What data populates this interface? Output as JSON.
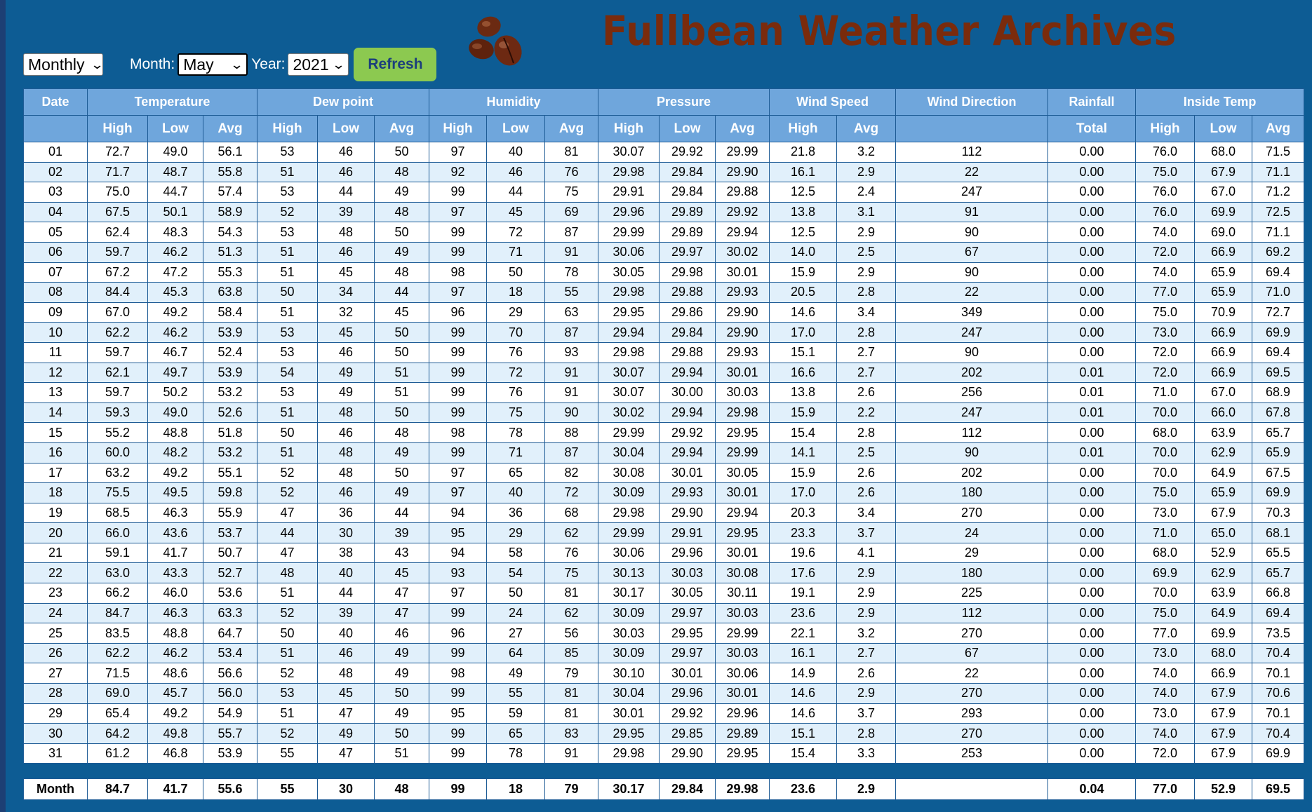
{
  "controls": {
    "period": "Monthly",
    "month_label": "Month:",
    "month": "May",
    "year_label": "Year:",
    "year": "2021",
    "refresh_label": "Refresh"
  },
  "title": "Fullbean Weather Archives",
  "headers": {
    "groups": [
      "Date",
      "Temperature",
      "Dew point",
      "Humidity",
      "Pressure",
      "Wind Speed",
      "Wind Direction",
      "Rainfall",
      "Inside Temp"
    ],
    "sub": [
      "",
      "High",
      "Low",
      "Avg",
      "High",
      "Low",
      "Avg",
      "High",
      "Low",
      "Avg",
      "High",
      "Low",
      "Avg",
      "High",
      "Avg",
      "",
      "Total",
      "High",
      "Low",
      "Avg"
    ]
  },
  "rows": [
    [
      "01",
      "72.7",
      "49.0",
      "56.1",
      "53",
      "46",
      "50",
      "97",
      "40",
      "81",
      "30.07",
      "29.92",
      "29.99",
      "21.8",
      "3.2",
      "112",
      "0.00",
      "76.0",
      "68.0",
      "71.5"
    ],
    [
      "02",
      "71.7",
      "48.7",
      "55.8",
      "51",
      "46",
      "48",
      "92",
      "46",
      "76",
      "29.98",
      "29.84",
      "29.90",
      "16.1",
      "2.9",
      "22",
      "0.00",
      "75.0",
      "67.9",
      "71.1"
    ],
    [
      "03",
      "75.0",
      "44.7",
      "57.4",
      "53",
      "44",
      "49",
      "99",
      "44",
      "75",
      "29.91",
      "29.84",
      "29.88",
      "12.5",
      "2.4",
      "247",
      "0.00",
      "76.0",
      "67.0",
      "71.2"
    ],
    [
      "04",
      "67.5",
      "50.1",
      "58.9",
      "52",
      "39",
      "48",
      "97",
      "45",
      "69",
      "29.96",
      "29.89",
      "29.92",
      "13.8",
      "3.1",
      "91",
      "0.00",
      "76.0",
      "69.9",
      "72.5"
    ],
    [
      "05",
      "62.4",
      "48.3",
      "54.3",
      "53",
      "48",
      "50",
      "99",
      "72",
      "87",
      "29.99",
      "29.89",
      "29.94",
      "12.5",
      "2.9",
      "90",
      "0.00",
      "74.0",
      "69.0",
      "71.1"
    ],
    [
      "06",
      "59.7",
      "46.2",
      "51.3",
      "51",
      "46",
      "49",
      "99",
      "71",
      "91",
      "30.06",
      "29.97",
      "30.02",
      "14.0",
      "2.5",
      "67",
      "0.00",
      "72.0",
      "66.9",
      "69.2"
    ],
    [
      "07",
      "67.2",
      "47.2",
      "55.3",
      "51",
      "45",
      "48",
      "98",
      "50",
      "78",
      "30.05",
      "29.98",
      "30.01",
      "15.9",
      "2.9",
      "90",
      "0.00",
      "74.0",
      "65.9",
      "69.4"
    ],
    [
      "08",
      "84.4",
      "45.3",
      "63.8",
      "50",
      "34",
      "44",
      "97",
      "18",
      "55",
      "29.98",
      "29.88",
      "29.93",
      "20.5",
      "2.8",
      "22",
      "0.00",
      "77.0",
      "65.9",
      "71.0"
    ],
    [
      "09",
      "67.0",
      "49.2",
      "58.4",
      "51",
      "32",
      "45",
      "96",
      "29",
      "63",
      "29.95",
      "29.86",
      "29.90",
      "14.6",
      "3.4",
      "349",
      "0.00",
      "75.0",
      "70.9",
      "72.7"
    ],
    [
      "10",
      "62.2",
      "46.2",
      "53.9",
      "53",
      "45",
      "50",
      "99",
      "70",
      "87",
      "29.94",
      "29.84",
      "29.90",
      "17.0",
      "2.8",
      "247",
      "0.00",
      "73.0",
      "66.9",
      "69.9"
    ],
    [
      "11",
      "59.7",
      "46.7",
      "52.4",
      "53",
      "46",
      "50",
      "99",
      "76",
      "93",
      "29.98",
      "29.88",
      "29.93",
      "15.1",
      "2.7",
      "90",
      "0.00",
      "72.0",
      "66.9",
      "69.4"
    ],
    [
      "12",
      "62.1",
      "49.7",
      "53.9",
      "54",
      "49",
      "51",
      "99",
      "72",
      "91",
      "30.07",
      "29.94",
      "30.01",
      "16.6",
      "2.7",
      "202",
      "0.01",
      "72.0",
      "66.9",
      "69.5"
    ],
    [
      "13",
      "59.7",
      "50.2",
      "53.2",
      "53",
      "49",
      "51",
      "99",
      "76",
      "91",
      "30.07",
      "30.00",
      "30.03",
      "13.8",
      "2.6",
      "256",
      "0.01",
      "71.0",
      "67.0",
      "68.9"
    ],
    [
      "14",
      "59.3",
      "49.0",
      "52.6",
      "51",
      "48",
      "50",
      "99",
      "75",
      "90",
      "30.02",
      "29.94",
      "29.98",
      "15.9",
      "2.2",
      "247",
      "0.01",
      "70.0",
      "66.0",
      "67.8"
    ],
    [
      "15",
      "55.2",
      "48.8",
      "51.8",
      "50",
      "46",
      "48",
      "98",
      "78",
      "88",
      "29.99",
      "29.92",
      "29.95",
      "15.4",
      "2.8",
      "112",
      "0.00",
      "68.0",
      "63.9",
      "65.7"
    ],
    [
      "16",
      "60.0",
      "48.2",
      "53.2",
      "51",
      "48",
      "49",
      "99",
      "71",
      "87",
      "30.04",
      "29.94",
      "29.99",
      "14.1",
      "2.5",
      "90",
      "0.01",
      "70.0",
      "62.9",
      "65.9"
    ],
    [
      "17",
      "63.2",
      "49.2",
      "55.1",
      "52",
      "48",
      "50",
      "97",
      "65",
      "82",
      "30.08",
      "30.01",
      "30.05",
      "15.9",
      "2.6",
      "202",
      "0.00",
      "70.0",
      "64.9",
      "67.5"
    ],
    [
      "18",
      "75.5",
      "49.5",
      "59.8",
      "52",
      "46",
      "49",
      "97",
      "40",
      "72",
      "30.09",
      "29.93",
      "30.01",
      "17.0",
      "2.6",
      "180",
      "0.00",
      "75.0",
      "65.9",
      "69.9"
    ],
    [
      "19",
      "68.5",
      "46.3",
      "55.9",
      "47",
      "36",
      "44",
      "94",
      "36",
      "68",
      "29.98",
      "29.90",
      "29.94",
      "20.3",
      "3.4",
      "270",
      "0.00",
      "73.0",
      "67.9",
      "70.3"
    ],
    [
      "20",
      "66.0",
      "43.6",
      "53.7",
      "44",
      "30",
      "39",
      "95",
      "29",
      "62",
      "29.99",
      "29.91",
      "29.95",
      "23.3",
      "3.7",
      "24",
      "0.00",
      "71.0",
      "65.0",
      "68.1"
    ],
    [
      "21",
      "59.1",
      "41.7",
      "50.7",
      "47",
      "38",
      "43",
      "94",
      "58",
      "76",
      "30.06",
      "29.96",
      "30.01",
      "19.6",
      "4.1",
      "29",
      "0.00",
      "68.0",
      "52.9",
      "65.5"
    ],
    [
      "22",
      "63.0",
      "43.3",
      "52.7",
      "48",
      "40",
      "45",
      "93",
      "54",
      "75",
      "30.13",
      "30.03",
      "30.08",
      "17.6",
      "2.9",
      "180",
      "0.00",
      "69.9",
      "62.9",
      "65.7"
    ],
    [
      "23",
      "66.2",
      "46.0",
      "53.6",
      "51",
      "44",
      "47",
      "97",
      "50",
      "81",
      "30.17",
      "30.05",
      "30.11",
      "19.1",
      "2.9",
      "225",
      "0.00",
      "70.0",
      "63.9",
      "66.8"
    ],
    [
      "24",
      "84.7",
      "46.3",
      "63.3",
      "52",
      "39",
      "47",
      "99",
      "24",
      "62",
      "30.09",
      "29.97",
      "30.03",
      "23.6",
      "2.9",
      "112",
      "0.00",
      "75.0",
      "64.9",
      "69.4"
    ],
    [
      "25",
      "83.5",
      "48.8",
      "64.7",
      "50",
      "40",
      "46",
      "96",
      "27",
      "56",
      "30.03",
      "29.95",
      "29.99",
      "22.1",
      "3.2",
      "270",
      "0.00",
      "77.0",
      "69.9",
      "73.5"
    ],
    [
      "26",
      "62.2",
      "46.2",
      "53.4",
      "51",
      "46",
      "49",
      "99",
      "64",
      "85",
      "30.09",
      "29.97",
      "30.03",
      "16.1",
      "2.7",
      "67",
      "0.00",
      "73.0",
      "68.0",
      "70.4"
    ],
    [
      "27",
      "71.5",
      "48.6",
      "56.6",
      "52",
      "48",
      "49",
      "98",
      "49",
      "79",
      "30.10",
      "30.01",
      "30.06",
      "14.9",
      "2.6",
      "22",
      "0.00",
      "74.0",
      "66.9",
      "70.1"
    ],
    [
      "28",
      "69.0",
      "45.7",
      "56.0",
      "53",
      "45",
      "50",
      "99",
      "55",
      "81",
      "30.04",
      "29.96",
      "30.01",
      "14.6",
      "2.9",
      "270",
      "0.00",
      "74.0",
      "67.9",
      "70.6"
    ],
    [
      "29",
      "65.4",
      "49.2",
      "54.9",
      "51",
      "47",
      "49",
      "95",
      "59",
      "81",
      "30.01",
      "29.92",
      "29.96",
      "14.6",
      "3.7",
      "293",
      "0.00",
      "73.0",
      "67.9",
      "70.1"
    ],
    [
      "30",
      "64.2",
      "49.8",
      "55.7",
      "52",
      "49",
      "50",
      "99",
      "65",
      "83",
      "29.95",
      "29.85",
      "29.89",
      "15.1",
      "2.8",
      "270",
      "0.00",
      "74.0",
      "67.9",
      "70.4"
    ],
    [
      "31",
      "61.2",
      "46.8",
      "53.9",
      "55",
      "47",
      "51",
      "99",
      "78",
      "91",
      "29.98",
      "29.90",
      "29.95",
      "15.4",
      "3.3",
      "253",
      "0.00",
      "72.0",
      "67.9",
      "69.9"
    ]
  ],
  "summary": [
    "Month",
    "84.7",
    "41.7",
    "55.6",
    "55",
    "30",
    "48",
    "99",
    "18",
    "79",
    "30.17",
    "29.84",
    "29.98",
    "23.6",
    "2.9",
    "",
    "0.04",
    "77.0",
    "52.9",
    "69.5"
  ]
}
